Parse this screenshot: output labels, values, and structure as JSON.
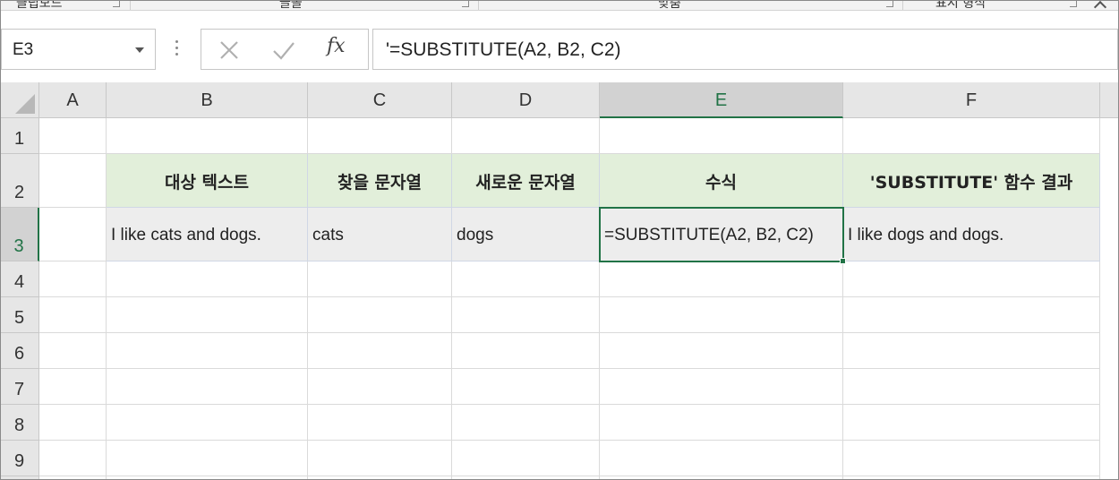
{
  "ribbon": {
    "groups": [
      "클립보드",
      "글꼴",
      "맞춤",
      "표시 형식"
    ]
  },
  "formula_bar": {
    "name_box": "E3",
    "fx_label": "fx",
    "formula": "'=SUBSTITUTE(A2, B2, C2)"
  },
  "grid": {
    "columns": [
      "A",
      "B",
      "C",
      "D",
      "E",
      "F"
    ],
    "active_column": "E",
    "rows": [
      "1",
      "2",
      "3",
      "4",
      "5",
      "6",
      "7",
      "8",
      "9"
    ],
    "active_row": "3",
    "headers": {
      "B2": "대상 텍스트",
      "C2": "찾을 문자열",
      "D2": "새로운 문자열",
      "E2": "수식",
      "F2": "'SUBSTITUTE' 함수 결과"
    },
    "data": {
      "B3": "I like cats and dogs.",
      "C3": "cats",
      "D3": "dogs",
      "E3": "=SUBSTITUTE(A2, B2, C2)",
      "F3": "I like dogs and dogs."
    }
  },
  "colors": {
    "accent_green": "#217346",
    "header_fill": "#e2efda",
    "data_fill": "#ededed"
  }
}
